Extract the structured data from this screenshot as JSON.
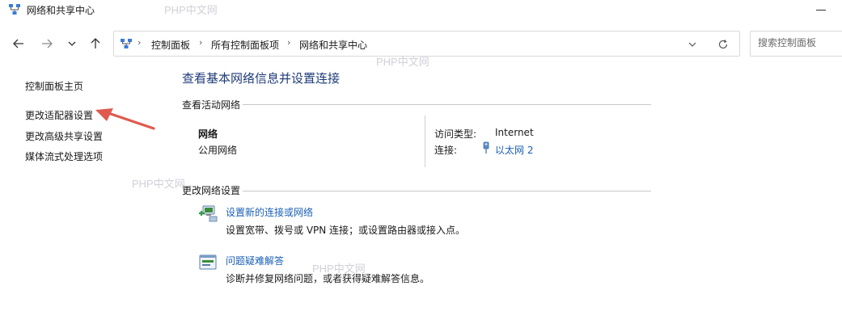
{
  "window": {
    "title": "网络和共享中心"
  },
  "address": {
    "breadcrumbs": [
      "控制面板",
      "所有控制面板项",
      "网络和共享中心"
    ]
  },
  "search": {
    "placeholder": "搜索控制面板"
  },
  "sidebar": {
    "items": [
      {
        "label": "控制面板主页"
      },
      {
        "label": "更改适配器设置"
      },
      {
        "label": "更改高级共享设置"
      },
      {
        "label": "媒体流式处理选项"
      }
    ]
  },
  "main": {
    "title": "查看基本网络信息并设置连接",
    "active_networks": {
      "heading": "查看活动网络",
      "network_name": "网络",
      "network_type": "公用网络",
      "access_type_label": "访问类型:",
      "access_type_value": "Internet",
      "connection_label": "连接:",
      "connection_value": "以太网 2"
    },
    "change_settings": {
      "heading": "更改网络设置",
      "tasks": [
        {
          "title": "设置新的连接或网络",
          "description": "设置宽带、拨号或 VPN 连接；或设置路由器或接入点。",
          "icon": "network-setup-icon"
        },
        {
          "title": "问题疑难解答",
          "description": "诊断并修复网络问题，或者获得疑难解答信息。",
          "icon": "troubleshoot-icon"
        }
      ]
    }
  },
  "annotation": {
    "arrow_color": "#e05a4f"
  },
  "watermark": {
    "text": "PHP中文网"
  },
  "colors": {
    "title": "#1e3b7a",
    "link": "#1a5fb4"
  }
}
